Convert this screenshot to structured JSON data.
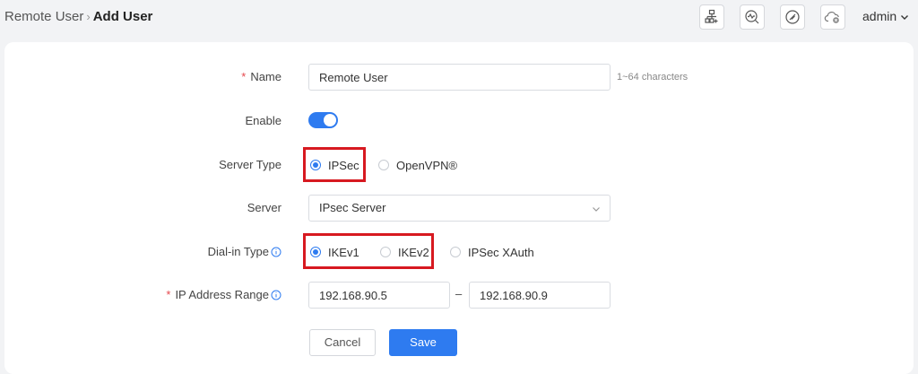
{
  "header": {
    "breadcrumb_parent": "Remote User",
    "breadcrumb_current": "Add User",
    "user_label": "admin",
    "tools": [
      "network-topology-icon",
      "network-diagnosis-icon",
      "block-icon",
      "cloud-disconnected-icon"
    ]
  },
  "form": {
    "name": {
      "label": "Name",
      "value": "Remote User",
      "hint": "1~64 characters"
    },
    "enable": {
      "label": "Enable",
      "on": true
    },
    "server_type": {
      "label": "Server Type",
      "options": [
        "IPSec",
        "OpenVPN®"
      ],
      "selected": "IPSec"
    },
    "server": {
      "label": "Server",
      "value": "IPsec Server"
    },
    "dial_in_type": {
      "label": "Dial-in Type",
      "options": [
        "IKEv1",
        "IKEv2",
        "IPSec XAuth"
      ],
      "selected": "IKEv1"
    },
    "ip_range": {
      "label": "IP Address Range",
      "start": "192.168.90.5",
      "separator": "–",
      "end": "192.168.90.9"
    },
    "cancel_label": "Cancel",
    "save_label": "Save"
  },
  "colors": {
    "accent": "#2e7bf0",
    "highlight": "#d71920",
    "required": "#e5484d"
  }
}
